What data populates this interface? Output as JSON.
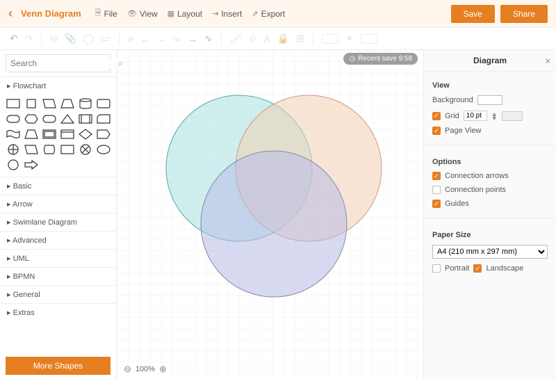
{
  "title": "Venn Diagram",
  "menu": {
    "file": "File",
    "view": "View",
    "layout": "Layout",
    "insert": "Insert",
    "export": "Export"
  },
  "buttons": {
    "save": "Save",
    "share": "Share",
    "more_shapes": "More Shapes"
  },
  "search": {
    "placeholder": "Search"
  },
  "shape_categories": {
    "flowchart": "Flowchart",
    "basic": "Basic",
    "arrow": "Arrow",
    "swimlane": "Swimlane Diagram",
    "advanced": "Advanced",
    "uml": "UML",
    "bpmn": "BPMN",
    "general": "General",
    "extras": "Extras"
  },
  "status": {
    "recent_save": "Recent save 9:58",
    "zoom": "100%"
  },
  "panel": {
    "title": "Diagram",
    "view": "View",
    "background": "Background",
    "grid": "Grid",
    "grid_value": "10 pt",
    "page_view": "Page View",
    "options": "Options",
    "conn_arrows": "Connection arrows",
    "conn_points": "Connection points",
    "guides": "Guides",
    "paper_size": "Paper Size",
    "paper_value": "A4 (210 mm x 297 mm)",
    "portrait": "Portrait",
    "landscape": "Landscape"
  },
  "colors": {
    "accent": "#e67e22",
    "circle1": "#a6e1e0",
    "circle2": "#f3d0b2",
    "circle3": "#b8bce8"
  }
}
